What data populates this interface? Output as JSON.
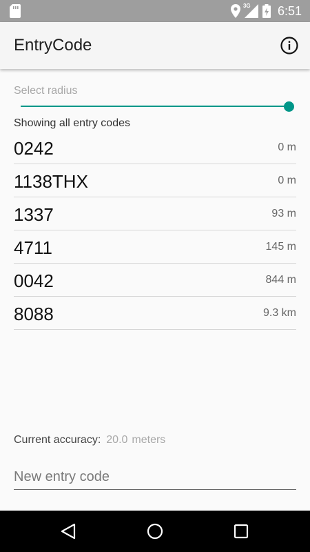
{
  "status_bar": {
    "time": "6:51",
    "network_label": "3G",
    "icons": [
      "sd-card-icon",
      "location-icon",
      "signal-icon",
      "battery-icon"
    ]
  },
  "app_bar": {
    "title": "EntryCode",
    "info_icon": "info-icon"
  },
  "radius": {
    "label": "Select radius",
    "slider_value": 1.0
  },
  "list_header": "Showing all entry codes",
  "codes": [
    {
      "code": "0242",
      "distance": "0 m"
    },
    {
      "code": "1138THX",
      "distance": "0 m"
    },
    {
      "code": "1337",
      "distance": "93 m"
    },
    {
      "code": "4711",
      "distance": "145 m"
    },
    {
      "code": "0042",
      "distance": "844 m"
    },
    {
      "code": "8088",
      "distance": "9.3 km"
    }
  ],
  "accuracy": {
    "label": "Current accuracy:",
    "value": "20.0",
    "unit": "meters"
  },
  "entry_input": {
    "placeholder": "New entry code",
    "value": ""
  },
  "nav_bar": {
    "icons": [
      "back-icon",
      "home-icon",
      "recents-icon"
    ]
  },
  "colors": {
    "accent": "#009688",
    "status_bar": "#9e9e9e",
    "app_bar": "#f5f5f5",
    "background": "#fafafa",
    "nav_bar": "#000000"
  }
}
